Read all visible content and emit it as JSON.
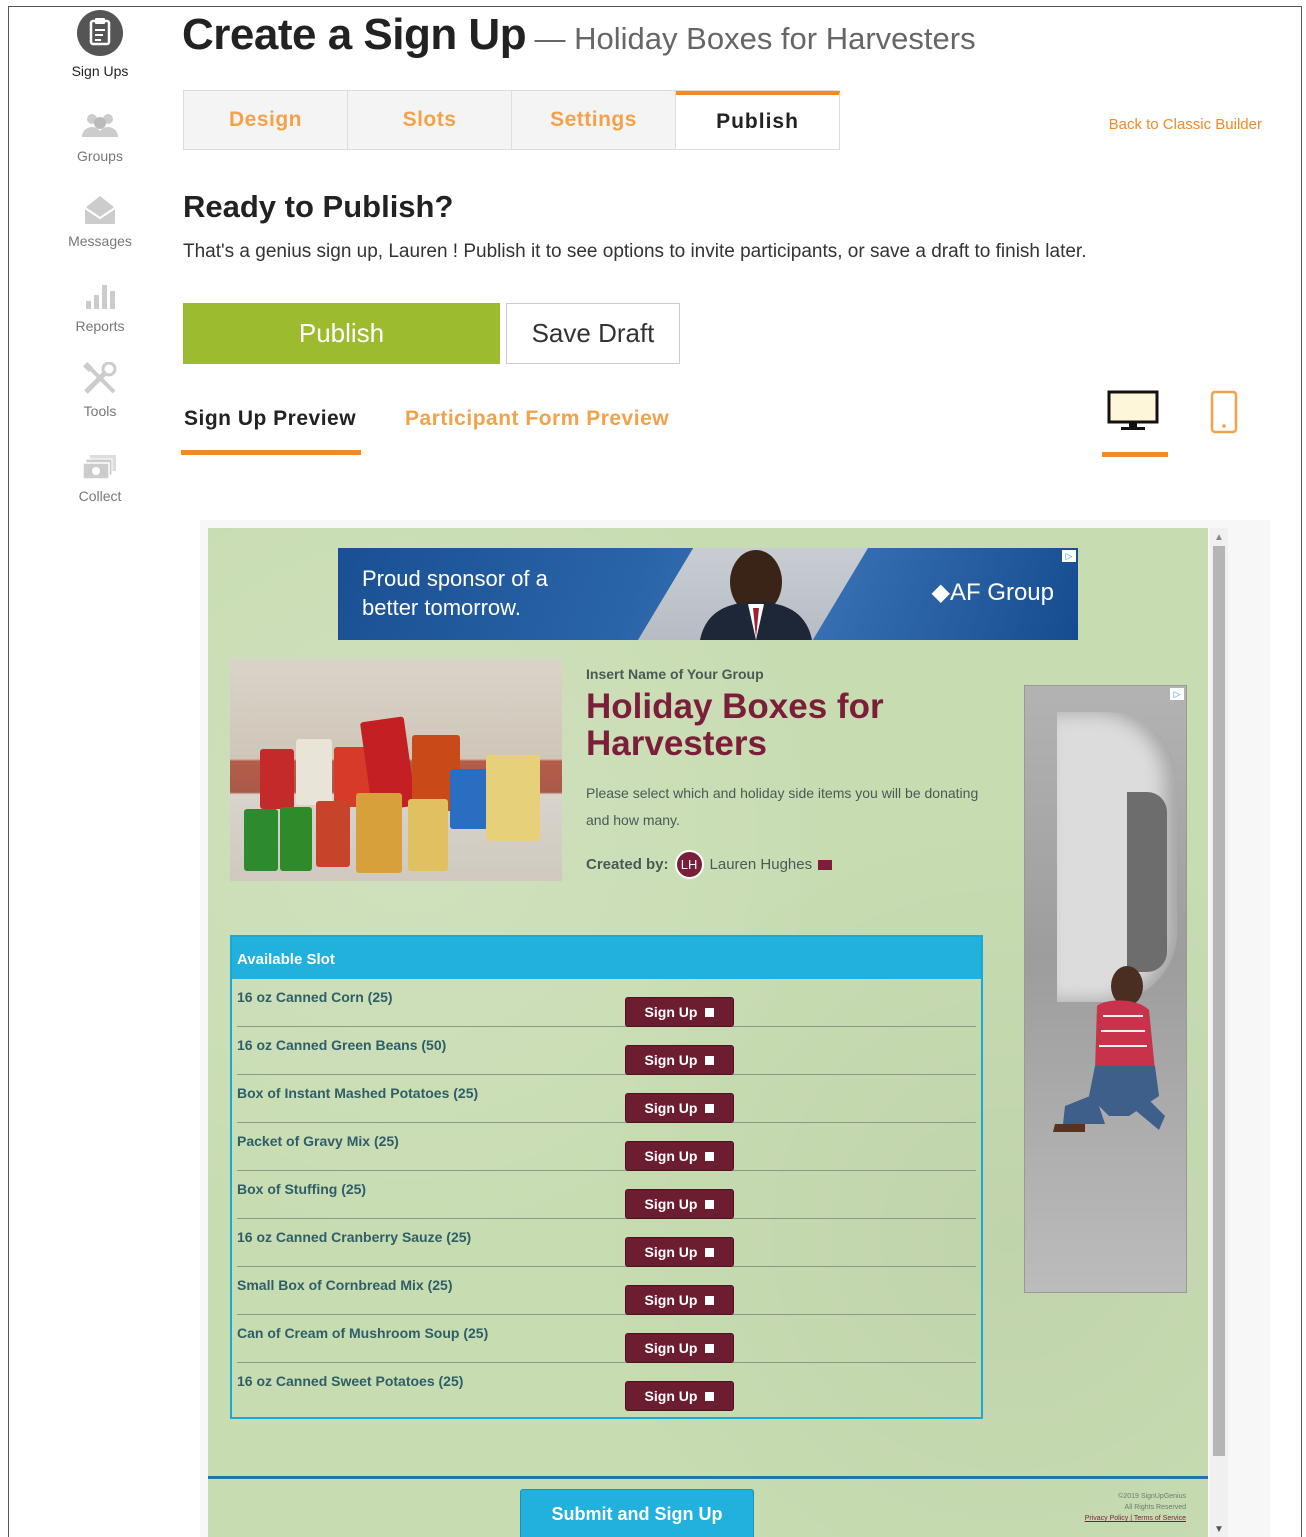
{
  "sidebar": {
    "items": [
      {
        "label": "Sign Ups",
        "icon": "clipboard-icon"
      },
      {
        "label": "Groups",
        "icon": "people-icon"
      },
      {
        "label": "Messages",
        "icon": "envelope-icon"
      },
      {
        "label": "Reports",
        "icon": "bar-chart-icon"
      },
      {
        "label": "Tools",
        "icon": "tools-icon"
      },
      {
        "label": "Collect",
        "icon": "cash-icon"
      }
    ]
  },
  "header": {
    "title": "Create a Sign Up",
    "subtitle": "— Holiday Boxes for Harvesters"
  },
  "tabs": [
    {
      "label": "Design"
    },
    {
      "label": "Slots"
    },
    {
      "label": "Settings"
    },
    {
      "label": "Publish",
      "active": true
    }
  ],
  "classic_link": "Back to Classic Builder",
  "ready": {
    "heading": "Ready to Publish?",
    "text": "That's a genius sign up, Lauren ! Publish it to see options to invite participants, or save a draft to finish later."
  },
  "buttons": {
    "publish": "Publish",
    "save_draft": "Save Draft"
  },
  "preview_tabs": {
    "signup_preview": "Sign Up Preview",
    "participant_preview": "Participant Form Preview"
  },
  "colors": {
    "accent": "#f08b25",
    "publish_green": "#9dbb2e",
    "preview_bg": "#c8dcb2",
    "title_maroon": "#7a1e3a",
    "slot_header": "#22b0dc"
  },
  "preview": {
    "ad": {
      "line1": "Proud sponsor of a",
      "line2": "better tomorrow.",
      "brand": "AF Group"
    },
    "group_name": "Insert Name of Your Group",
    "title": "Holiday Boxes for Harvesters",
    "description": "Please select which and holiday side items you will be donating and how many.",
    "created_by_label": "Created by:",
    "creator_initials": "LH",
    "creator_name": "Lauren Hughes",
    "table_header": "Available Slot",
    "signup_label": "Sign Up",
    "slots": [
      "16 oz Canned Corn (25)",
      "16 oz Canned Green Beans (50)",
      "Box of Instant Mashed Potatoes (25)",
      "Packet of Gravy Mix (25)",
      "Box of Stuffing (25)",
      "16 oz Canned Cranberry Sauze (25)",
      "Small Box of Cornbread Mix (25)",
      "Can of Cream of Mushroom Soup (25)",
      "16 oz Canned Sweet Potatoes (25)"
    ],
    "submit_label": "Submit and Sign Up",
    "footer_copyright": "©2019 SignUpGenius",
    "footer_rights": "All Rights Reserved",
    "footer_privacy": "Privacy Policy",
    "footer_sep": "|",
    "footer_terms": "Terms of Service"
  }
}
